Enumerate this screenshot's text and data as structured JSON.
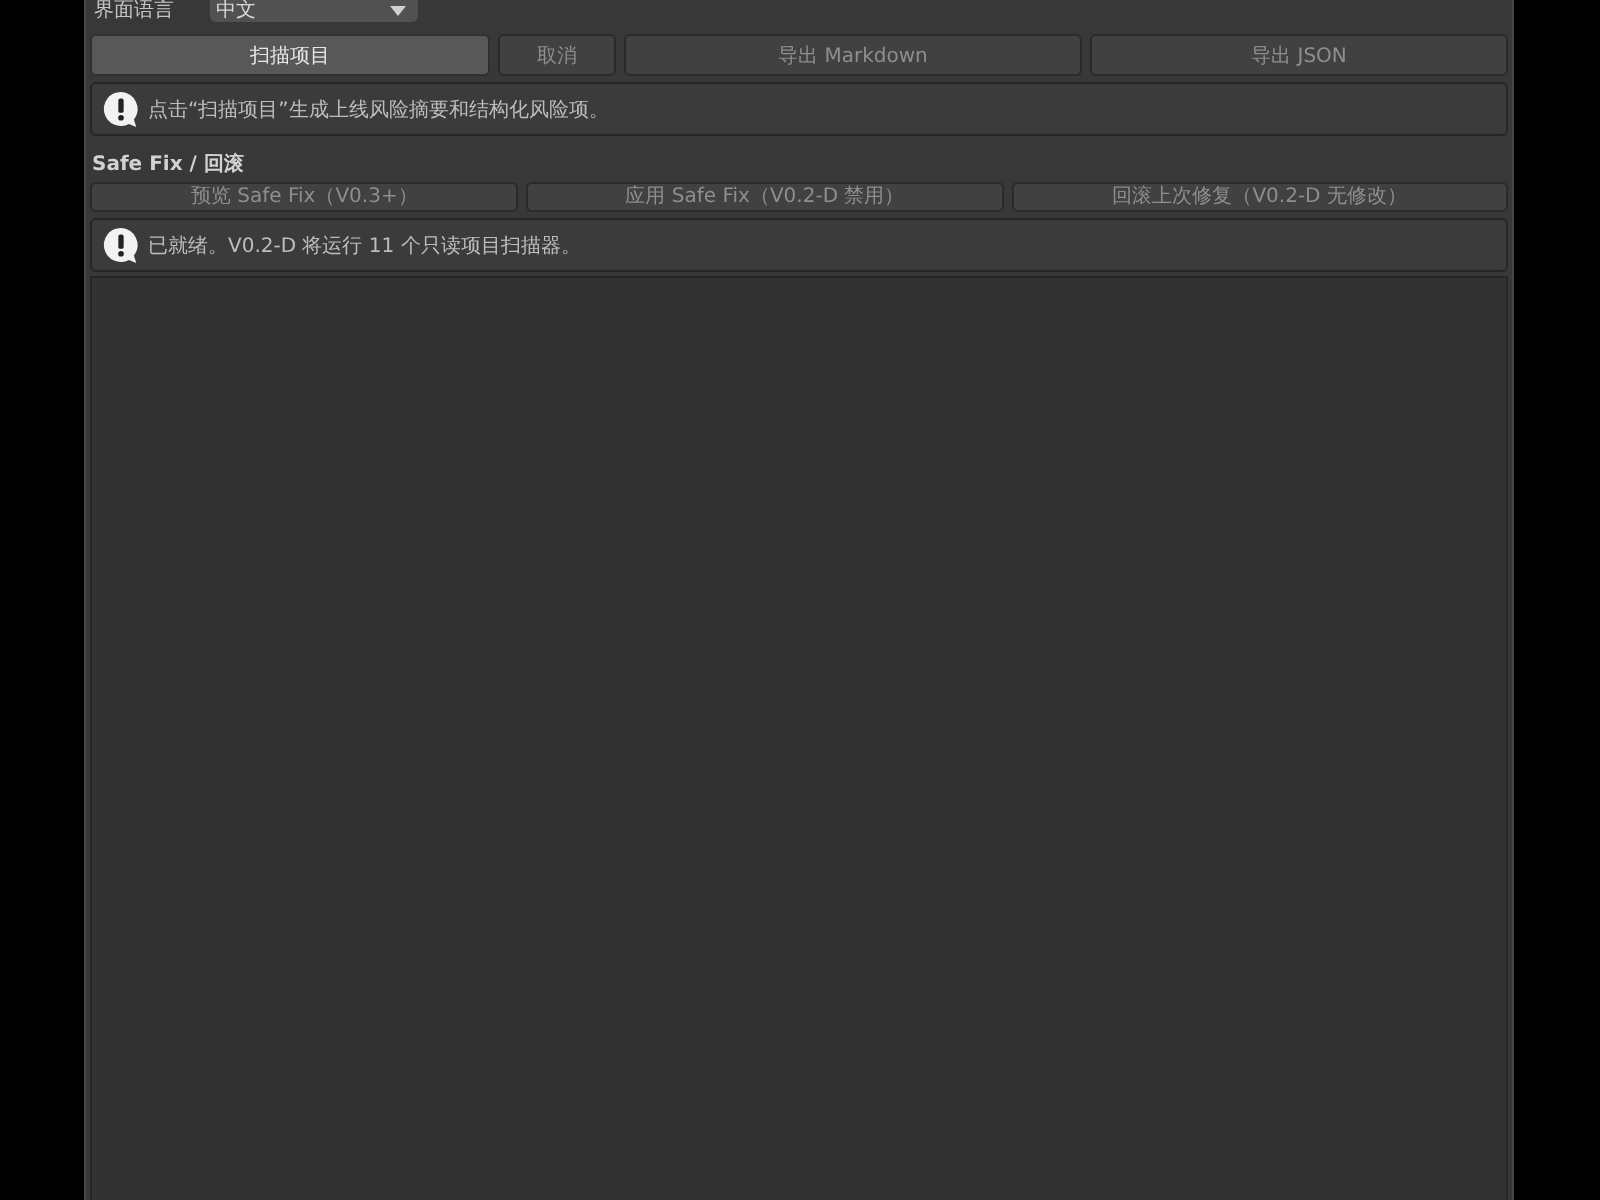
{
  "language_row": {
    "label": "界面语言",
    "dropdown": {
      "value": "中文"
    }
  },
  "actions": [
    {
      "label": "扫描项目",
      "disabled": false
    },
    {
      "label": "取消",
      "disabled": true
    },
    {
      "label": "导出 Markdown",
      "disabled": true
    },
    {
      "label": "导出 JSON",
      "disabled": true
    }
  ],
  "scan_help": {
    "kind": "info",
    "text": "点击“扫描项目”生成上线风险摘要和结构化风险项。"
  },
  "safe_fix": {
    "title": "Safe Fix / 回滚",
    "buttons": [
      {
        "label": "预览 Safe Fix（V0.3+）",
        "disabled": true
      },
      {
        "label": "应用 Safe Fix（V0.2-D 禁用）",
        "disabled": true
      },
      {
        "label": "回滚上次修复（V0.2-D 无修改）",
        "disabled": true
      }
    ],
    "help": {
      "kind": "info",
      "text": "已就绪。V0.2-D 将运行 11 个只读项目扫描器。"
    }
  }
}
